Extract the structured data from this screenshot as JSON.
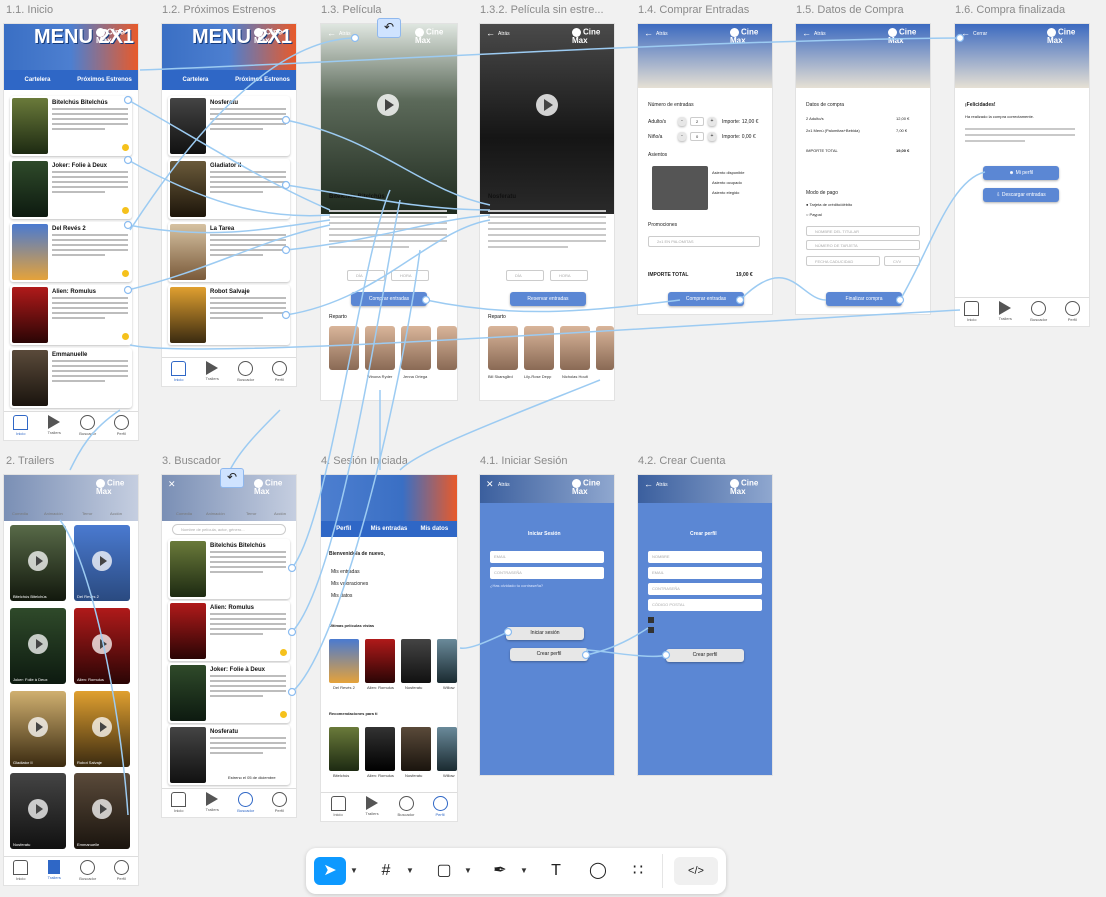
{
  "frames": {
    "inicio": "1.1. Inicio",
    "proximos": "1.2. Próximos Estrenos",
    "pelicula": "1.3. Película",
    "pelicula_sin": "1.3.2. Película sin estre...",
    "comprar": "1.4. Comprar Entradas",
    "datos": "1.5. Datos de Compra",
    "finalizada": "1.6. Compra finalizada",
    "trailers": "2. Trailers",
    "buscador": "3. Buscador",
    "sesion": "4. Sesión Iniciada",
    "iniciar": "4.1. Iniciar Sesión",
    "crear": "4.2. Crear Cuenta"
  },
  "common": {
    "menu_banner": "MENU 2X1",
    "logo": "Cine Max",
    "tab_cartelera": "Cartelera",
    "tab_proximos": "Próximos Estrenos",
    "back": "Atrás",
    "close": "Cerrar",
    "nav": [
      "Inicio",
      "Trailers",
      "Buscador",
      "Perfil"
    ]
  },
  "inicio": {
    "movies": [
      "Bitelchús Bitelchús",
      "Joker: Folie à Deux",
      "Del Revés 2",
      "Alien: Romulus",
      "Emmanuelle"
    ]
  },
  "proximos": {
    "movies": [
      "Nosferatu",
      "Gladiator II",
      "La Tarea",
      "Robot Salvaje"
    ]
  },
  "pelicula": {
    "title": "Bitelchús Bitelchús",
    "date_placeholder": "DÍA",
    "time_placeholder": "HORA",
    "buy": "Comprar entradas",
    "cast_label": "Reparto",
    "cast": [
      "",
      "Winona Ryder",
      "Jenna Ortega"
    ]
  },
  "pelicula_sin": {
    "title": "Nosferatu",
    "date_placeholder": "DÍA",
    "time_placeholder": "HORA",
    "reserve": "Reservar entradas",
    "cast_label": "Reparto",
    "cast": [
      "Bill Skarsgård",
      "Lily-Rose Depp",
      "Nicholas Hoult"
    ]
  },
  "comprar": {
    "entries_label": "Número de entradas",
    "adult": "Adulto/s",
    "adult_qty": "2",
    "adult_price": "Importe: 12,00 €",
    "child": "Niño/a",
    "child_qty": "0",
    "child_price": "Importe: 0,00 €",
    "seats_label": "Asientos",
    "legend": [
      "Asiento disponible",
      "Asiento ocupado",
      "Asiento elegido"
    ],
    "promo_label": "Promociones",
    "promo_value": "2x1 EN PALOMITAS",
    "total_label": "IMPORTE TOTAL",
    "total_value": "19,00 €",
    "buy": "Comprar entradas"
  },
  "datos": {
    "section": "Datos de compra",
    "items": [
      [
        "2 Adulto/s",
        "12,00 €"
      ],
      [
        "2x1 Menú (Palomitas+Bebida)",
        "7,00 €"
      ]
    ],
    "total_label": "IMPORTE TOTAL",
    "total_value": "19,00 €",
    "pay_label": "Modo de pago",
    "pay_card": "Tarjeta de crédito/débito",
    "pay_paypal": "Paypal",
    "card_holder": "NOMBRE DEL TITULAR",
    "card_number": "NÚMERO DE TARJETA",
    "card_expiry": "FECHA CADUCIDAD",
    "card_cvv": "CVV",
    "finish": "Finalizar compra"
  },
  "finalizada": {
    "title": "¡Felicidades!",
    "line1": "Ha realizado la compra correctamente.",
    "btn_profile": "Mi perfil",
    "btn_download": "Descargar entradas"
  },
  "trailers": {
    "categories": [
      "Comedia",
      "Animación",
      "Terror",
      "Acción"
    ],
    "items": [
      "Bitelchús Bitelchús",
      "Del Revés 2",
      "Joker: Folie à Deux",
      "Alien: Romulus",
      "Gladiator II",
      "Robot Salvaje",
      "Nosferatu",
      "Emmanuelle"
    ]
  },
  "buscador": {
    "search_placeholder": "Nombre de película, actor, género...",
    "categories": [
      "Comedia",
      "Animación",
      "Terror",
      "Acción"
    ],
    "movies": [
      "Bitelchús Bitelchús",
      "Alien: Romulus",
      "Joker: Folie à Deux",
      "Nosferatu"
    ],
    "estreno": "Estreno el 05 de diciembre"
  },
  "sesion": {
    "tabs": [
      "Perfil",
      "Mis entradas",
      "Mis datos"
    ],
    "welcome": "Bienvenido/a de nuevo,",
    "menu": [
      "Mis entradas",
      "Mis valoraciones",
      "Mis datos"
    ],
    "seen_label": "Últimas películas vistas",
    "seen": [
      "Del Revés 2",
      "Alien: Romulus",
      "Nosferatu",
      "Willow"
    ],
    "rec_label": "Recomendaciones para ti",
    "rec": [
      "Bitelchús",
      "Alien: Romulus",
      "Nosferatu",
      "Willow"
    ]
  },
  "iniciar": {
    "title": "Iniciar Sesión",
    "email": "EMAIL",
    "password": "CONTRASEÑA",
    "forgot": "¿Has olvidado tu contraseña?",
    "login": "Iniciar sesión",
    "create": "Crear perfil"
  },
  "crear": {
    "title": "Crear perfil",
    "fields": [
      "NOMBRE",
      "EMAIL",
      "CONTRASEÑA",
      "CÓDIGO POSTAL"
    ],
    "create": "Crear perfil"
  },
  "toolbar": {
    "tools": [
      "move-tool",
      "frame-tool",
      "shape-tool",
      "pen-tool",
      "text-tool",
      "comment-tool",
      "actions-tool",
      "dev-mode-toggle"
    ],
    "text_glyph": "T",
    "dev_glyph": "</>"
  }
}
